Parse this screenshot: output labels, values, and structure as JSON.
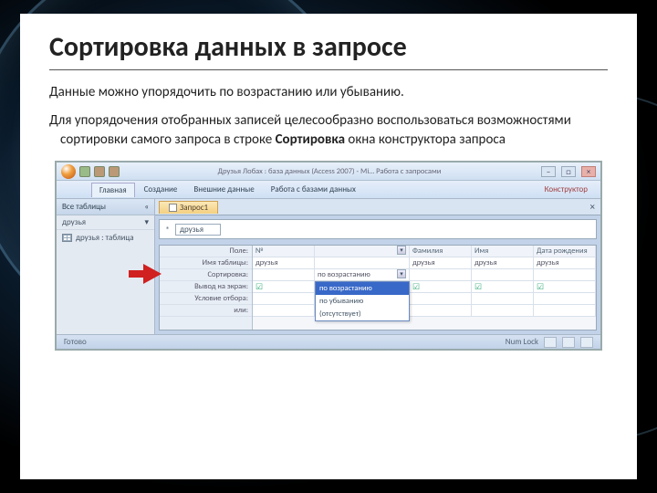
{
  "slide": {
    "title": "Сортировка данных в запросе",
    "para1": "Данные можно упорядочить по возрастанию или убыванию.",
    "para2_a": "Для упорядочения отобранных записей целесообразно воспользоваться возможностями сортировки самого запроса в строке ",
    "para2_bold": "Сортировка",
    "para2_b": " окна конструктора запроса"
  },
  "access": {
    "title": "Друзья Лобах : база данных (Access 2007) - Mi…    Работа с запросами",
    "ribbon_tabs": [
      "Главная",
      "Создание",
      "Внешние данные",
      "Работа с базами данных",
      "Конструктор"
    ],
    "nav": {
      "header": "Все таблицы",
      "category": "друзья",
      "item": "друзья : таблица"
    },
    "doc_tab": "Запрос1",
    "upper_field": "друзья",
    "grid": {
      "row_labels": [
        "Поле:",
        "Имя таблицы:",
        "Сортировка:",
        "Вывод на экран:",
        "Условие отбора:",
        "или:"
      ],
      "col_headers": [
        "№",
        "Фамилия",
        "Имя",
        "Дата рождения"
      ],
      "table_row": [
        "друзья",
        "друзья",
        "друзья",
        "друзья"
      ],
      "sort_value": "по возрастанию",
      "sort_options": [
        "по возрастанию",
        "по убыванию",
        "(отсутствует)"
      ]
    },
    "status": {
      "left": "Готово",
      "lock": "Num Lock"
    }
  }
}
